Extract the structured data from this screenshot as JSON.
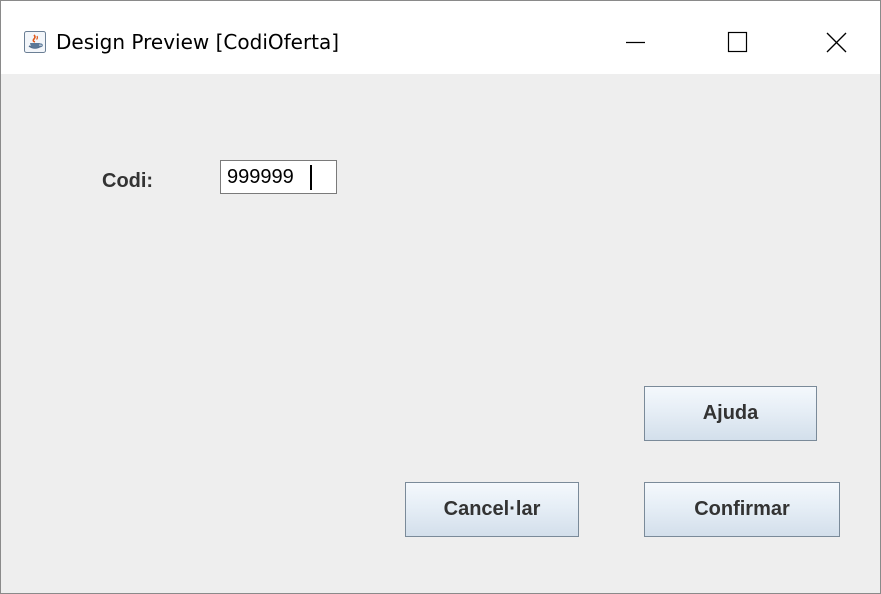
{
  "window": {
    "title": "Design Preview [CodiOferta]",
    "icons": {
      "app": "java-coffee-icon",
      "minimize": "minimize-icon",
      "maximize": "maximize-icon",
      "close": "close-icon"
    }
  },
  "form": {
    "codi_label": "Codi:",
    "codi_value": "999999"
  },
  "buttons": {
    "help_label": "Ajuda",
    "cancel_label": "Cancel·lar",
    "confirm_label": "Confirmar"
  },
  "colors": {
    "window_background": "#eeeeee",
    "titlebar_background": "#ffffff",
    "button_gradient_top": "#f4f8fc",
    "button_gradient_bottom": "#d3dfeb",
    "button_border": "#7a8a99",
    "label_text": "#333333"
  }
}
